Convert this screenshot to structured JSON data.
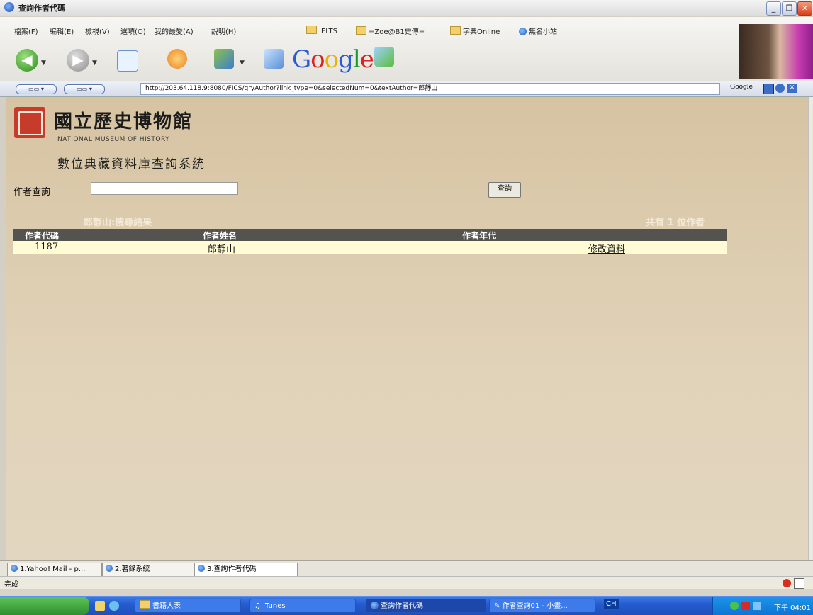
{
  "window": {
    "title": "查詢作者代碼"
  },
  "menu": [
    "檔案(F)",
    "編輯(E)",
    "檢視(V)",
    "選項(O)",
    "我的最愛(A)",
    "說明(H)"
  ],
  "bookmarks": [
    "IELTS",
    "=Zoe@B1史傳=",
    "字典Online",
    "無名小站"
  ],
  "toolbar": {
    "google_logo": "Google"
  },
  "address": {
    "url": "http://203.64.118.9:8080/FICS/qryAuthor?link_type=0&selectedNum=0&textAuthor=郎靜山",
    "search_label": "Google"
  },
  "page": {
    "museum_name_zh": "國立歷史博物館",
    "museum_name_en": "NATIONAL MUSEUM OF HISTORY",
    "system_title": "數位典藏資料庫查詢系統",
    "search_label": "作者查詢",
    "search_value": "",
    "search_button": "查詢",
    "result_caption": "郎靜山:搜尋結果",
    "result_count": "共有 1 位作者",
    "table": {
      "headers": [
        "作者代碼",
        "作者姓名",
        "作者年代"
      ],
      "rows": [
        {
          "code": "1187",
          "name": "郎靜山",
          "era": "",
          "action": "修改資料"
        }
      ]
    }
  },
  "tabs": [
    "1.Yahoo! Mail - p...",
    "2.著錄系統",
    "3.查詢作者代碼"
  ],
  "status": {
    "text": "完成"
  },
  "taskbar": {
    "tasks": [
      "書籍大表",
      "iTunes",
      "查詢作者代碼",
      "作者查詢01 - 小畫..."
    ],
    "tray": {
      "ime": "CH",
      "time": "下午 04:01"
    }
  }
}
